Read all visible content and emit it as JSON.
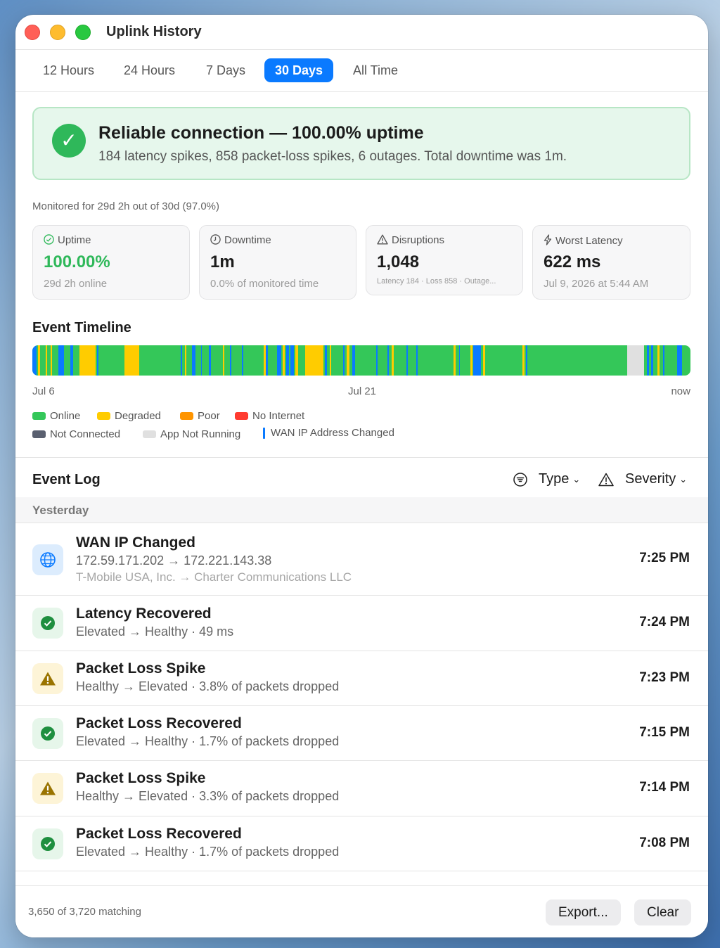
{
  "window": {
    "title": "Uplink History"
  },
  "tabs": [
    {
      "label": "12 Hours",
      "active": false
    },
    {
      "label": "24 Hours",
      "active": false
    },
    {
      "label": "7 Days",
      "active": false
    },
    {
      "label": "30 Days",
      "active": true
    },
    {
      "label": "All Time",
      "active": false
    }
  ],
  "banner": {
    "icon": "checkmark-circle-icon",
    "title": "Reliable connection — 100.00% uptime",
    "subtitle": "184 latency spikes, 858 packet-loss spikes, 6 outages. Total downtime was 1m."
  },
  "monitored": "Monitored for 29d 2h out of 30d (97.0%)",
  "cards": {
    "uptime": {
      "icon": "check-circle-icon",
      "label": "Uptime",
      "value": "100.00%",
      "sub": "29d 2h online"
    },
    "downtime": {
      "icon": "clock-icon",
      "label": "Downtime",
      "value": "1m",
      "sub": "0.0% of monitored time"
    },
    "disruptions": {
      "icon": "warning-triangle-icon",
      "label": "Disruptions",
      "value": "1,048",
      "sub": "Latency 184 · Loss 858 · Outage..."
    },
    "worst_latency": {
      "icon": "bolt-icon",
      "label": "Worst Latency",
      "value": "622 ms",
      "sub": "Jul 9, 2026 at 5:44 AM"
    }
  },
  "timeline": {
    "title": "Event Timeline",
    "start_label": "Jul 6",
    "mid_label": "Jul 21",
    "end_label": "now",
    "colors": {
      "online": "#34c759",
      "degraded": "#ffcc00",
      "poor": "#ff9500",
      "no_internet": "#ff3b30",
      "not_connected": "#5a6070",
      "app_not_running": "#e0e0e0",
      "wan_ip_changed": "#0a7aff"
    },
    "segments": [
      {
        "start": 0.0,
        "end": 0.006,
        "state": "wan_ip_changed"
      },
      {
        "start": 0.009,
        "end": 0.012,
        "state": "degraded"
      },
      {
        "start": 0.02,
        "end": 0.022,
        "state": "degraded"
      },
      {
        "start": 0.028,
        "end": 0.03,
        "state": "degraded"
      },
      {
        "start": 0.04,
        "end": 0.048,
        "state": "wan_ip_changed"
      },
      {
        "start": 0.058,
        "end": 0.062,
        "state": "wan_ip_changed"
      },
      {
        "start": 0.072,
        "end": 0.096,
        "state": "degraded"
      },
      {
        "start": 0.098,
        "end": 0.1,
        "state": "wan_ip_changed"
      },
      {
        "start": 0.14,
        "end": 0.162,
        "state": "degraded"
      },
      {
        "start": 0.225,
        "end": 0.228,
        "state": "wan_ip_changed"
      },
      {
        "start": 0.232,
        "end": 0.234,
        "state": "degraded"
      },
      {
        "start": 0.242,
        "end": 0.248,
        "state": "wan_ip_changed"
      },
      {
        "start": 0.256,
        "end": 0.258,
        "state": "wan_ip_changed"
      },
      {
        "start": 0.268,
        "end": 0.271,
        "state": "wan_ip_changed"
      },
      {
        "start": 0.29,
        "end": 0.292,
        "state": "degraded"
      },
      {
        "start": 0.3,
        "end": 0.302,
        "state": "wan_ip_changed"
      },
      {
        "start": 0.318,
        "end": 0.321,
        "state": "wan_ip_changed"
      },
      {
        "start": 0.352,
        "end": 0.356,
        "state": "degraded"
      },
      {
        "start": 0.355,
        "end": 0.358,
        "state": "wan_ip_changed"
      },
      {
        "start": 0.372,
        "end": 0.378,
        "state": "wan_ip_changed"
      },
      {
        "start": 0.38,
        "end": 0.384,
        "state": "degraded"
      },
      {
        "start": 0.386,
        "end": 0.39,
        "state": "wan_ip_changed"
      },
      {
        "start": 0.392,
        "end": 0.397,
        "state": "wan_ip_changed"
      },
      {
        "start": 0.4,
        "end": 0.404,
        "state": "degraded"
      },
      {
        "start": 0.414,
        "end": 0.442,
        "state": "degraded"
      },
      {
        "start": 0.444,
        "end": 0.448,
        "state": "wan_ip_changed"
      },
      {
        "start": 0.452,
        "end": 0.454,
        "state": "degraded"
      },
      {
        "start": 0.472,
        "end": 0.474,
        "state": "wan_ip_changed"
      },
      {
        "start": 0.478,
        "end": 0.482,
        "state": "degraded"
      },
      {
        "start": 0.486,
        "end": 0.49,
        "state": "wan_ip_changed"
      },
      {
        "start": 0.522,
        "end": 0.525,
        "state": "wan_ip_changed"
      },
      {
        "start": 0.54,
        "end": 0.542,
        "state": "wan_ip_changed"
      },
      {
        "start": 0.546,
        "end": 0.549,
        "state": "degraded"
      },
      {
        "start": 0.568,
        "end": 0.571,
        "state": "wan_ip_changed"
      },
      {
        "start": 0.583,
        "end": 0.586,
        "state": "wan_ip_changed"
      },
      {
        "start": 0.64,
        "end": 0.643,
        "state": "degraded"
      },
      {
        "start": 0.648,
        "end": 0.65,
        "state": "wan_ip_changed"
      },
      {
        "start": 0.666,
        "end": 0.669,
        "state": "degraded"
      },
      {
        "start": 0.67,
        "end": 0.682,
        "state": "wan_ip_changed"
      },
      {
        "start": 0.685,
        "end": 0.688,
        "state": "degraded"
      },
      {
        "start": 0.745,
        "end": 0.748,
        "state": "degraded"
      },
      {
        "start": 0.75,
        "end": 0.752,
        "state": "wan_ip_changed"
      },
      {
        "start": 0.904,
        "end": 0.93,
        "state": "app_not_running"
      },
      {
        "start": 0.934,
        "end": 0.937,
        "state": "wan_ip_changed"
      },
      {
        "start": 0.94,
        "end": 0.943,
        "state": "wan_ip_changed"
      },
      {
        "start": 0.95,
        "end": 0.953,
        "state": "degraded"
      },
      {
        "start": 0.958,
        "end": 0.961,
        "state": "wan_ip_changed"
      },
      {
        "start": 0.98,
        "end": 0.987,
        "state": "wan_ip_changed"
      }
    ]
  },
  "legend": [
    {
      "label": "Online",
      "state": "online"
    },
    {
      "label": "Degraded",
      "state": "degraded"
    },
    {
      "label": "Poor",
      "state": "poor"
    },
    {
      "label": "No Internet",
      "state": "no_internet"
    },
    {
      "label": "Not Connected",
      "state": "not_connected"
    },
    {
      "label": "App Not Running",
      "state": "app_not_running"
    },
    {
      "label": "WAN IP Address Changed",
      "state": "wan_ip_changed"
    }
  ],
  "event_log": {
    "title": "Event Log",
    "filter_type": "Type",
    "filter_severity": "Severity",
    "group": "Yesterday",
    "rows": [
      {
        "icon": "globe-icon",
        "kind": "info",
        "title": "WAN IP Changed",
        "sub": "172.59.171.202 → 172.221.143.38",
        "sub2": "T-Mobile USA, Inc. → Charter Communications LLC",
        "time": "7:25 PM"
      },
      {
        "icon": "check-circle-icon",
        "kind": "ok",
        "title": "Latency Recovered",
        "sub": "Elevated → Healthy · 49 ms",
        "time": "7:24 PM"
      },
      {
        "icon": "warning-triangle-icon",
        "kind": "warn",
        "title": "Packet Loss Spike",
        "sub": "Healthy → Elevated · 3.8% of packets dropped",
        "time": "7:23 PM"
      },
      {
        "icon": "check-circle-icon",
        "kind": "ok",
        "title": "Packet Loss Recovered",
        "sub": "Elevated → Healthy · 1.7% of packets dropped",
        "time": "7:15 PM"
      },
      {
        "icon": "warning-triangle-icon",
        "kind": "warn",
        "title": "Packet Loss Spike",
        "sub": "Healthy → Elevated · 3.3% of packets dropped",
        "time": "7:14 PM"
      },
      {
        "icon": "check-circle-icon",
        "kind": "ok",
        "title": "Packet Loss Recovered",
        "sub": "Elevated → Healthy · 1.7% of packets dropped",
        "time": "7:08 PM"
      }
    ]
  },
  "footer": {
    "count": "3,650 of 3,720 matching",
    "export_label": "Export...",
    "clear_label": "Clear"
  }
}
